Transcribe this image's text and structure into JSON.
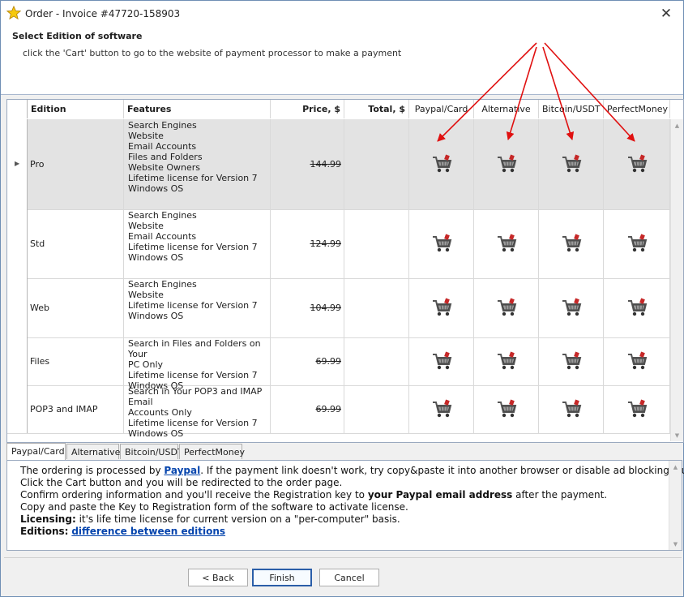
{
  "window": {
    "title": "Order - Invoice #47720-158903"
  },
  "header": {
    "title": "Select Edition of software",
    "subtitle": "click the 'Cart' button to go to the website of payment processor to make a payment"
  },
  "grid": {
    "columns": {
      "edition": "Edition",
      "features": "Features",
      "price": "Price, $",
      "total": "Total, $",
      "pay1": "Paypal/Card",
      "pay2": "Alternative",
      "pay3": "Bitcoin/USDT",
      "pay4": "PerfectMoney"
    },
    "rows": [
      {
        "edition": "Pro",
        "features": [
          "Search Engines",
          "Website",
          "Email Accounts",
          "Files and Folders",
          "Website Owners",
          "Lifetime license for Version 7",
          "Windows OS"
        ],
        "price": "144.99",
        "selected": true
      },
      {
        "edition": "Std",
        "features": [
          "Search Engines",
          "Website",
          "Email Accounts",
          "Lifetime license for Version 7",
          "Windows OS"
        ],
        "price": "124.99",
        "selected": false
      },
      {
        "edition": "Web",
        "features": [
          "Search Engines",
          "Website",
          "Lifetime license for Version 7",
          "Windows OS"
        ],
        "price": "104.99",
        "selected": false
      },
      {
        "edition": "Files",
        "features": [
          "Search in Files and Folders on Your",
          "PC Only",
          "Lifetime license for Version 7",
          "Windows OS"
        ],
        "price": "69.99",
        "selected": false
      },
      {
        "edition": "POP3 and IMAP",
        "features": [
          "Search in Your POP3 and IMAP Email",
          "Accounts Only",
          "Lifetime license for Version 7",
          "Windows OS"
        ],
        "price": "69.99",
        "selected": false
      }
    ],
    "cart_icon": "shopping-cart-icon"
  },
  "tabs": [
    "Paypal/Card",
    "Alternative",
    "Bitcoin/USDT",
    "PerfectMoney"
  ],
  "info": {
    "l1a": "The ordering is processed by ",
    "l1link": "Paypal",
    "l1b": ". If the payment link doesn't work, try copy&paste it into another browser or disable ad blocking plugins!",
    "l2": "Click the Cart button and you will be redirected to the order page.",
    "l3a": "Confirm ordering information and you'll receive the Registration key to ",
    "l3b": "your Paypal email address",
    "l3c": " after the payment.",
    "l4": "Copy and paste the Key to Registration form of the software to activate license.",
    "l5a": "Licensing:",
    "l5b": " it's life time license for current version on a \"per-computer\" basis.",
    "l6a": "Editions:",
    "l6link": "difference between editions"
  },
  "buttons": {
    "back": "< Back",
    "finish": "Finish",
    "cancel": "Cancel"
  },
  "colors": {
    "annotation_arrow": "#e01010",
    "link": "#0645ad",
    "selected_row": "#e3e3e3",
    "default_button_border": "#2b5ea8"
  }
}
